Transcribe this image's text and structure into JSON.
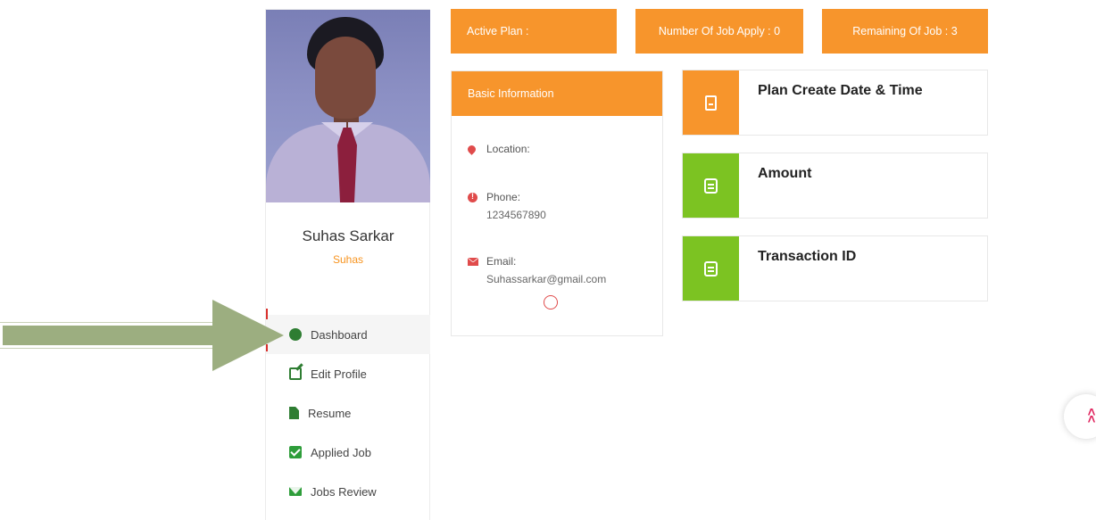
{
  "profile": {
    "name": "Suhas Sarkar",
    "username": "Suhas"
  },
  "menu": {
    "items": [
      {
        "label": "Dashboard",
        "icon": "dashboard-icon"
      },
      {
        "label": "Edit Profile",
        "icon": "edit-icon"
      },
      {
        "label": "Resume",
        "icon": "file-icon"
      },
      {
        "label": "Applied Job",
        "icon": "check-square-icon"
      },
      {
        "label": "Jobs Review",
        "icon": "envelope-icon"
      }
    ]
  },
  "stats": {
    "active_plan": "Active Plan :",
    "jobs_applied": "Number Of Job Apply : 0",
    "remaining": "Remaining Of Job : 3"
  },
  "basic_info": {
    "title": "Basic Information",
    "location_label": "Location:",
    "phone_label": "Phone:",
    "phone_value": "1234567890",
    "email_label": "Email:",
    "email_value": "Suhassarkar@gmail.com"
  },
  "cards": [
    {
      "title": "Plan Create Date & Time",
      "icon": "book-icon"
    },
    {
      "title": "Amount",
      "icon": "receipt-icon"
    },
    {
      "title": "Transaction ID",
      "icon": "receipt-icon"
    }
  ],
  "colors": {
    "accent_orange": "#f7952c",
    "accent_green": "#7cc322",
    "menu_icon_green": "#2e9d3a",
    "username_orange": "#f7931e",
    "info_icon_red": "#e04b4b"
  }
}
